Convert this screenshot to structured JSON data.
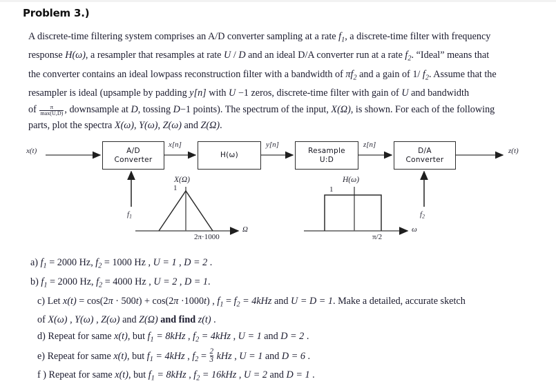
{
  "title": "Problem 3.)",
  "intro": {
    "line1_a": "A discrete-time filtering system comprises an A/D converter sampling at a rate ",
    "line1_f1": "f",
    "line1_f1_sub": "1",
    "line1_b": ", a discrete-time filter with frequency",
    "line2_a": "response ",
    "line2_H": "H",
    "line2_Homega": "(ω)",
    "line2_b": ", a resampler that resamples at rate ",
    "line2_U": "U",
    "line2_slash": " / ",
    "line2_D": "D",
    "line2_c": " and an ideal D/A converter run at a rate ",
    "line2_f2": "f",
    "line2_f2_sub": "2",
    "line2_d": ". “Ideal” means that",
    "line3_a": "the converter contains an ideal lowpass reconstruction filter with a bandwidth of ",
    "line3_pi": "π",
    "line3_f2": "f",
    "line3_f2_sub": "2",
    "line3_b": " and a gain of 1/ ",
    "line3_f2b": "f",
    "line3_f2b_sub": "2",
    "line3_c": ". Assume that the",
    "line4_a": "resampler is ideal (upsample by padding ",
    "line4_y": "y",
    "line4_yn": "[n]",
    "line4_b": " with ",
    "line4_U": "U",
    "line4_c": " −1 zeros, discrete-time filter with gain of ",
    "line4_U2": "U",
    "line4_d": " and bandwidth",
    "line5_of": "of ",
    "line5_frac_num": "π",
    "line5_frac_den": "max(U,D)",
    "line5_a": ", downsample at ",
    "line5_D": "D",
    "line5_b": ", tossing ",
    "line5_D2": "D",
    "line5_c": "−1 points). The spectrum of the input, ",
    "line5_X": "X",
    "line5_Xomega": "(Ω)",
    "line5_d": ", is shown. For each of the following",
    "line6_a": "parts, plot the spectra ",
    "line6_X": "X",
    "line6_Xo": "(ω)",
    "line6_sep1": ", ",
    "line6_Y": "Y",
    "line6_Yo": "(ω)",
    "line6_sep2": ", ",
    "line6_Z": "Z",
    "line6_Zo": "(ω)",
    "line6_and": " and ",
    "line6_ZO": "Z",
    "line6_ZOmega": "(Ω)",
    "line6_end": "."
  },
  "diagram": {
    "input_signal": "x(t)",
    "output_signal": "z(t)",
    "blocks": [
      {
        "name": "ad-converter",
        "line1": "A/D",
        "line2": "Converter"
      },
      {
        "name": "filter",
        "line1": "H(ω)",
        "line2": ""
      },
      {
        "name": "resampler",
        "line1": "Resample",
        "line2": "U:D"
      },
      {
        "name": "da-converter",
        "line1": "D/A",
        "line2": "Converter"
      }
    ],
    "interconnect_labels": [
      "x[n]",
      "y[n]",
      "z[n]"
    ],
    "clock_labels": [
      "f1",
      "f2"
    ],
    "clock_label_1": "f",
    "clock_label_1_sub": "1",
    "clock_label_2": "f",
    "clock_label_2_sub": "2",
    "plot_input": {
      "title": "X(Ω)",
      "amplitude_label": "1",
      "axis_label": "Ω",
      "tick_label": "2π·1000",
      "shape": "triangle"
    },
    "plot_filter": {
      "title": "H(ω)",
      "amplitude_label": "1",
      "axis_label": "ω",
      "tick_label": "π/2",
      "shape": "rectangle"
    }
  },
  "parts": {
    "a": {
      "label": "a)",
      "f1": "f",
      "f1_sub": "1",
      "f1_val": " = 2000 Hz",
      "sep1": ",  ",
      "f2": "f",
      "f2_sub": "2",
      "f2_val": " = 1000 Hz",
      "sep2": " , ",
      "U": "U = 1",
      "sep3": " , ",
      "D": "D = 2",
      "end": " ."
    },
    "b": {
      "label": "b)",
      "f1": "f",
      "f1_sub": "1",
      "f1_val": " = 2000 Hz",
      "sep1": ",  ",
      "f2": "f",
      "f2_sub": "2",
      "f2_val": " = 4000 Hz",
      "sep2": " , ",
      "U": "U = 2",
      "sep3": " , ",
      "D": "D = 1",
      "end": "."
    },
    "c": {
      "label": "c)",
      "text1": " Let ",
      "xt": "x(t)",
      "text2": " = cos(2",
      "pi1": "π",
      "text3": " · 500",
      "t1": "t",
      "text4": ") + cos(2",
      "pi2": "π",
      "text5": " ·1000",
      "t2": "t",
      "text6": ") , ",
      "f1": "f",
      "f1_sub": "1",
      "eq1": " = ",
      "f2": "f",
      "f2_sub": "2",
      "eq2": " = 4kHz",
      "text7": "  and ",
      "UD": "U = D = 1",
      "text8": ". Make a detailed, accurate sketch",
      "line2_a": "of ",
      "line2_X": "X",
      "line2_Xo": "(ω)",
      "line2_s1": " , ",
      "line2_Y": "Y",
      "line2_Yo": "(ω)",
      "line2_s2": " , ",
      "line2_Z": "Z",
      "line2_Zo": "(ω)",
      "line2_and": " and ",
      "line2_ZO": "Z",
      "line2_ZOmega": "(Ω)",
      "line2_bold": " and find ",
      "line2_zt": "z(t)",
      "line2_end": " ."
    },
    "d": {
      "label": "d)",
      "text1": " Repeat for same ",
      "xt": "x(t)",
      "text2": ", but ",
      "f1": "f",
      "f1_sub": "1",
      "f1_val": " = 8kHz",
      "sep1": " , ",
      "f2": "f",
      "f2_sub": "2",
      "f2_val": " = 4kHz",
      "sep2": " , ",
      "U": "U = 1",
      "and": " and ",
      "D": "D = 2",
      "end": " ."
    },
    "e": {
      "label": "e)",
      "text1": " Repeat for same ",
      "xt": "x(t)",
      "text2": ", but ",
      "f1": "f",
      "f1_sub": "1",
      "f1_val": " = 4kHz",
      "sep1": " , ",
      "f2": "f",
      "f2_sub": "2",
      "f2_eq": " = ",
      "f2_num": "2",
      "f2_den": "3",
      "f2_unit": " kHz",
      "sep2": " , ",
      "U": "U = 1",
      "and": " and ",
      "D": "D = 6",
      "end": " ."
    },
    "f": {
      "label": "f )",
      "text1": " Repeat for same ",
      "xt": "x(t)",
      "text2": ", but ",
      "f1": "f",
      "f1_sub": "1",
      "f1_val": " = 8kHz",
      "sep1": " , ",
      "f2": "f",
      "f2_sub": "2",
      "f2_val": " = 16kHz",
      "sep2": " , ",
      "U": "U = 2",
      "and": " and ",
      "D": "D = 1",
      "end": " ."
    }
  },
  "colors": {
    "ink": "#1b1b2e",
    "line": "#2b2b2b",
    "page": "#ffffff"
  }
}
